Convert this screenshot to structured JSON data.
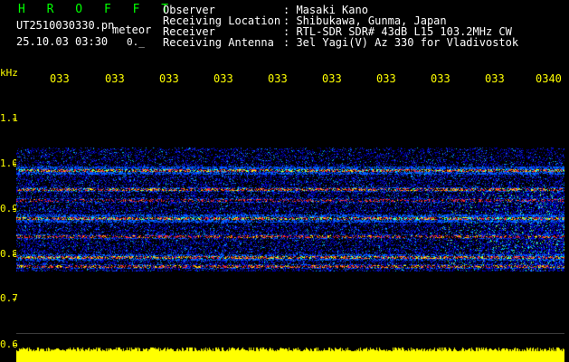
{
  "header": {
    "station": "H R O F F T",
    "filename": "UT2510030330.pn",
    "tag": "meteor",
    "datetime": "25.10.03 03:30",
    "count": "0._"
  },
  "info": {
    "labels": [
      "Observer",
      "Receiving Location",
      "Receiver",
      "Receiving Antenna"
    ],
    "values": [
      ": Masaki Kano",
      ": Shibukawa, Gunma, Japan",
      ": RTL-SDR SDR# 43dB L15 103.2MHz CW",
      ": 3el Yagi(V) Az 330 for Vladivostok"
    ]
  },
  "axes": {
    "y_unit": "kHz",
    "y_ticks": [
      "1.1",
      "1.0",
      "0.9",
      "0.8",
      "0.7",
      "0.6"
    ],
    "x_ticks": [
      "033",
      "033",
      "033",
      "033",
      "033",
      "033",
      "033",
      "033",
      "033",
      "0340"
    ]
  },
  "colors": {
    "background": "#000000",
    "title": "#00ff00",
    "text": "#ffffff",
    "axis": "#ffff00",
    "band": "#ff3030",
    "noise": "#0000c8",
    "signal": "#00ffff",
    "strong": "#ffff00",
    "activity": "#ffff00"
  }
}
